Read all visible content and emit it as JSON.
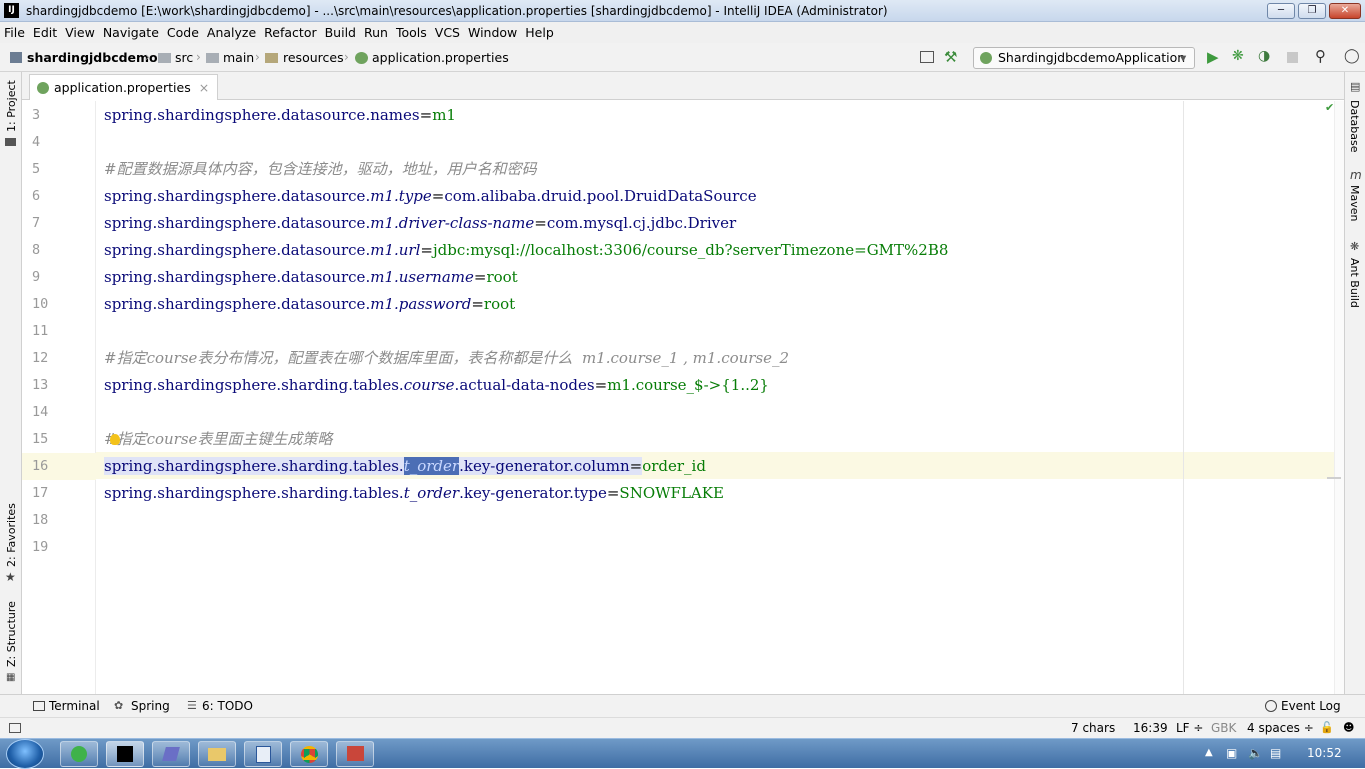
{
  "window": {
    "title": "shardingjdbcdemo [E:\\work\\shardingjdbcdemo] - ...\\src\\main\\resources\\application.properties [shardingjdbcdemo] - IntelliJ IDEA (Administrator)",
    "app_icon": "IJ"
  },
  "menu": [
    "File",
    "Edit",
    "View",
    "Navigate",
    "Code",
    "Analyze",
    "Refactor",
    "Build",
    "Run",
    "Tools",
    "VCS",
    "Window",
    "Help"
  ],
  "breadcrumbs": [
    "shardingjdbcdemo",
    "src",
    "main",
    "resources",
    "application.properties"
  ],
  "run_config": "ShardingjdbcdemoApplication",
  "left_tools": [
    "1: Project",
    "2: Favorites",
    "Z: Structure"
  ],
  "right_tools": [
    "Database",
    "Maven",
    "Ant Build"
  ],
  "tab": {
    "label": "application.properties",
    "close": "×"
  },
  "editor": {
    "line_numbers": [
      "3",
      "4",
      "5",
      "6",
      "7",
      "8",
      "9",
      "10",
      "11",
      "12",
      "13",
      "14",
      "15",
      "16",
      "17",
      "18",
      "19"
    ],
    "lines": [
      {
        "k": "spring.shardingsphere.datasource.names",
        "op": "=",
        "v": "m1"
      },
      {},
      {
        "c": "#配置数据源具体内容，包含连接池，驱动，地址，用户名和密码"
      },
      {
        "k": "spring.shardingsphere.datasource.",
        "it": "m1.type",
        "op": "=",
        "k2": "com.alibaba.druid.pool.DruidDataSource"
      },
      {
        "k": "spring.shardingsphere.datasource.",
        "it": "m1.driver-class-name",
        "op": "=",
        "k2": "com.mysql.cj.jdbc.Driver"
      },
      {
        "k": "spring.shardingsphere.datasource.",
        "it": "m1.url",
        "op": "=",
        "v": "jdbc:mysql://localhost:3306/course_db?serverTimezone=GMT%2B8"
      },
      {
        "k": "spring.shardingsphere.datasource.",
        "it": "m1.username",
        "op": "=",
        "v": "root"
      },
      {
        "k": "spring.shardingsphere.datasource.",
        "it": "m1.password",
        "op": "=",
        "v": "root"
      },
      {},
      {
        "c": "#指定course表分布情况，配置表在哪个数据库里面，表名称都是什么  m1.course_1 , m1.course_2"
      },
      {
        "k": "spring.shardingsphere.sharding.tables.",
        "it": "course",
        "k2": ".actual-data-nodes",
        "op": "=",
        "v": "m1.course_$->{1..2}"
      },
      {},
      {
        "c": "#指定course表里面主键生成策略"
      },
      {
        "k": "spring.shardingsphere.sharding.tables.",
        "sel": "t_order",
        "k2": ".key-generator.column",
        "op": "=",
        "v": "order_id"
      },
      {
        "k": "spring.shardingsphere.sharding.tables.",
        "it": "t_order",
        "k2": ".key-generator.type",
        "op": "=",
        "v": "SNOWFLAKE"
      },
      {},
      {}
    ]
  },
  "bottom_tools": {
    "terminal": "Terminal",
    "spring": "Spring",
    "todo": "6: TODO",
    "event_log": "Event Log"
  },
  "status": {
    "chars": "7 chars",
    "pos": "16:39",
    "lf": "LF ÷",
    "enc": "GBK",
    "indent": "4 spaces ÷"
  },
  "taskbar": {
    "clock": "10:52"
  }
}
